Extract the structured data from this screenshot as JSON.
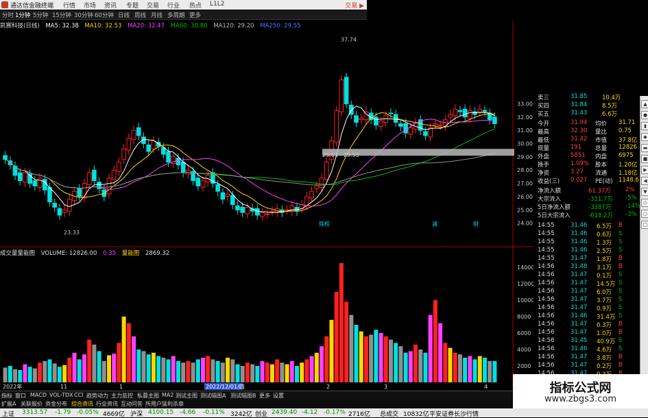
{
  "window": {
    "title": "通达信金融终端",
    "menu": [
      "行情",
      "市场",
      "资讯",
      "专题",
      "交易",
      "行业",
      "热点",
      "L1L2"
    ],
    "brand": "交易 ▶"
  },
  "periods": [
    "分时",
    "1分钟",
    "5分钟",
    "15分钟",
    "30分钟",
    "60分钟",
    "日线",
    "周线",
    "月线",
    "多周期",
    "更多"
  ],
  "main_legend": {
    "stock": "凯赛科技(日线)",
    "ma5": "MA5: 32.38",
    "ma10": "MA10: 32.53",
    "ma20": "MA20: 32.47",
    "ma60": "MA60: 30.80",
    "ma120": "MA120: 29.20",
    "ma250": "MA250: 29.55"
  },
  "annotations": {
    "high_label": "37.74",
    "low_label": "23.33",
    "range_label": "29.63 - 29.55",
    "marker_1": "除权",
    "marker_2": "减",
    "marker_3": "财"
  },
  "vol_legend": {
    "title": "成交量量能图",
    "volume": "VOLUME: 12826.00",
    "v1": "0.35",
    "v2": "量能图",
    "v3": "2869.32"
  },
  "axis": {
    "price_ticks": [
      "33.00",
      "32.00",
      "31.00",
      "30.00",
      "29.00",
      "28.00",
      "27.00",
      "26.00",
      "25.00",
      "24.00"
    ],
    "vol_ticks": [
      "14000",
      "12000",
      "10000",
      "8000",
      "6000",
      "4000",
      "2000"
    ],
    "date_left": "2022年",
    "date_mid": "2022/12/01/四",
    "date_marks": [
      "11",
      "1",
      "2",
      "3",
      "4"
    ]
  },
  "quote_panel": {
    "rows": [
      {
        "l": "卖三",
        "v": "31.85",
        "r": "10.4万"
      },
      {
        "l": "买四",
        "v": "31.84",
        "r": "8.5万"
      },
      {
        "l": "买五",
        "v": "31.43",
        "r": "6.6万"
      }
    ],
    "stats": [
      {
        "l": "今开",
        "v": "31.94",
        "l2": "均价",
        "v2": "31.71"
      },
      {
        "l": "最高",
        "v": "32.30",
        "l2": "量比",
        "v2": "0.75"
      },
      {
        "l": "最低",
        "v": "31.42",
        "l2": "市值",
        "v2": "37.8亿"
      },
      {
        "l": "现量",
        "v": "191",
        "l2": "总量",
        "v2": "12826"
      },
      {
        "l": "外盘",
        "v": "5851",
        "l2": "内盘",
        "v2": "6975"
      },
      {
        "l": "换手",
        "v": "1.09%",
        "l2": "股本",
        "v2": "1.20亿"
      },
      {
        "l": "净资",
        "v": "3.27",
        "l2": "流通",
        "v2": "1.18亿"
      },
      {
        "l": "收益(三)",
        "v": "0.027",
        "l2": "PE(动)",
        "v2": "1148.6"
      }
    ],
    "flows": [
      {
        "l": "净流入额",
        "v": "61.37万",
        "p": "2%"
      },
      {
        "l": "大宗流入",
        "v": "-311.7万",
        "p": "-5%"
      },
      {
        "l": "5日净流入额",
        "v": "-3387万",
        "p": "-14%"
      },
      {
        "l": "5日大宗流入",
        "v": "-618.2万",
        "p": "-3%"
      }
    ],
    "ticks": [
      {
        "t": "14:55",
        "p": "31.46",
        "q": "6.5万",
        "s": "B"
      },
      {
        "t": "14:55",
        "p": "31.46",
        "q": "0.6万",
        "s": "S"
      },
      {
        "t": "14:55",
        "p": "31.46",
        "q": "1.3万",
        "s": "S"
      },
      {
        "t": "14:55",
        "p": "31.46",
        "q": "2.5万",
        "s": "S"
      },
      {
        "t": "14:55",
        "p": "31.47",
        "q": "1.8万",
        "s": "B"
      },
      {
        "t": "14:56",
        "p": "31.48",
        "q": "3.1万",
        "s": "B"
      },
      {
        "t": "14:56",
        "p": "31.47",
        "q": "0.1万",
        "s": "S"
      },
      {
        "t": "14:56",
        "p": "31.47",
        "q": "14.5万",
        "s": "S"
      },
      {
        "t": "14:56",
        "p": "31.47",
        "q": "6.0万",
        "s": "S"
      },
      {
        "t": "14:56",
        "p": "31.47",
        "q": "3.7万",
        "s": "S"
      },
      {
        "t": "14:56",
        "p": "31.47",
        "q": "0.9万",
        "s": "S"
      },
      {
        "t": "14:56",
        "p": "31.46",
        "q": "31.4万",
        "s": "S"
      },
      {
        "t": "14:56",
        "p": "31.47",
        "q": "0.3万",
        "s": "B"
      },
      {
        "t": "14:56",
        "p": "31.47",
        "q": "1.0万",
        "s": "B"
      },
      {
        "t": "14:56",
        "p": "31.45",
        "q": "40.9万",
        "s": "S"
      },
      {
        "t": "14:56",
        "p": "31.46",
        "q": "4.6万",
        "s": "S"
      },
      {
        "t": "14:56",
        "p": "31.47",
        "q": "3.8万",
        "s": "B"
      },
      {
        "t": "14:56",
        "p": "31.47",
        "q": "0.2万",
        "s": "B"
      },
      {
        "t": "14:56",
        "p": "31.47",
        "q": "0.3万",
        "s": "B"
      }
    ]
  },
  "tabs_row1": [
    "指标",
    "窗口",
    "MACD",
    "VOL-TDX",
    "CCI",
    "趋势动力",
    "主力监控",
    "私募主图",
    "MA2",
    "测试主图",
    "测试幅图A",
    "测试幅图B",
    "更多",
    "设置"
  ],
  "tabs_row2": [
    "扩展A",
    "关联报价",
    "资金分布",
    "综合资讯",
    "行业资讯",
    "互动问答",
    "所用户猛利杀章"
  ],
  "status": {
    "sh_name": "上证",
    "sh_val": "3313.57",
    "sh_chg": "-1.79",
    "sh_pct": "-0.05%",
    "sh_amt": "4669亿",
    "sz_name": "沪深",
    "sz_val": "4100.15",
    "sz_chg": "-4.66",
    "sz_pct": "-0.11%",
    "sz_amt": "3242亿",
    "cy_name": "创业",
    "cy_val": "2439.40",
    "cy_chg": "-4.12",
    "cy_pct": "-0.17%",
    "cy_amt": "2716亿",
    "total_label": "总成交",
    "total_val": "10832亿",
    "broker": "平安证券长沙行情"
  },
  "watermark": {
    "line1": "指标公式网",
    "line2": "www.zbgs3.com"
  },
  "colors": {
    "up": "#ff2020",
    "down": "#00e0e0",
    "ma5": "#ffffff",
    "ma10": "#ffd700",
    "ma20": "#ff40ff",
    "ma60": "#00c000",
    "ma120": "#909090",
    "ma250": "#4060ff"
  }
}
